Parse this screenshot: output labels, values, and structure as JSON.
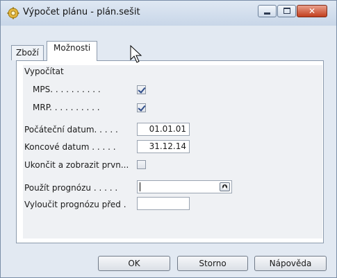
{
  "window": {
    "title": "Výpočet plánu - plán.sešit"
  },
  "tabs": [
    {
      "label": "Zboží",
      "active": false
    },
    {
      "label": "Možnosti",
      "active": true
    }
  ],
  "options": {
    "group_label": "Vypočítat",
    "mps": {
      "label": "MPS. . . . . . . . . .",
      "checked": true
    },
    "mrp": {
      "label": "MRP. . . . . . . . . .",
      "checked": true
    },
    "start_date": {
      "label": "Počáteční datum. . . . .",
      "value": "01.01.01"
    },
    "end_date": {
      "label": "Koncové datum . . . . .",
      "value": "31.12.14"
    },
    "stop_first": {
      "label": "Ukončit a zobrazit prvn...",
      "checked": false
    },
    "use_forecast": {
      "label": "Použít prognózu . . . . .",
      "value": ""
    },
    "exclude_forecast": {
      "label": "Vyloučit prognózu před  .",
      "value": ""
    }
  },
  "buttons": {
    "ok": "OK",
    "storno": "Storno",
    "help": "Nápověda"
  },
  "colors": {
    "titlebar": "#c8d6e8",
    "close_button": "#c23f1e",
    "check": "#2f4d8a"
  }
}
